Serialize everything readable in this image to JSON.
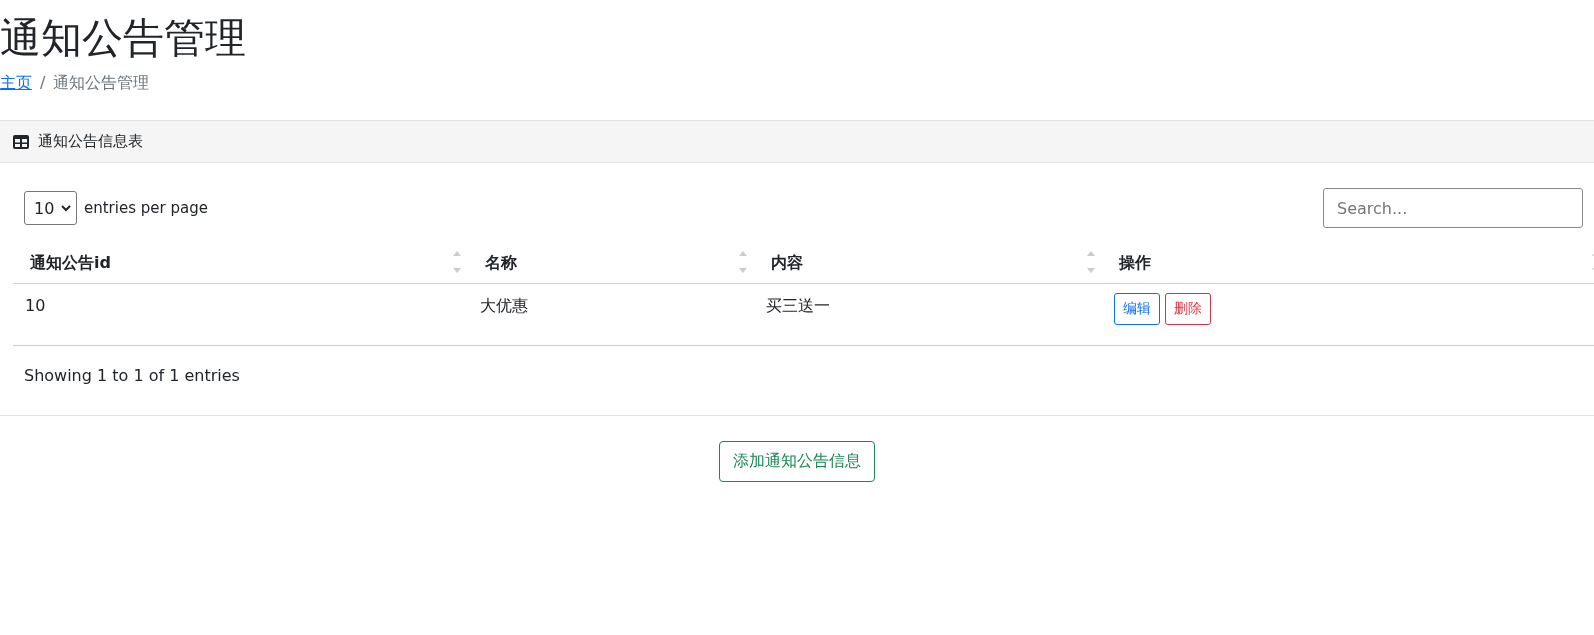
{
  "title": "通知公告管理",
  "breadcrumb": [
    {
      "label": "主页",
      "link": true
    },
    {
      "label": "通知公告管理",
      "link": false
    }
  ],
  "breadcrumb_separator": "/",
  "card": {
    "header": "通知公告信息表",
    "page_size": "10",
    "page_size_label": "entries per page",
    "search": {
      "placeholder": "Search..."
    },
    "columns": [
      "通知公告id",
      "名称",
      "内容",
      "操作"
    ],
    "rows": [
      {
        "cells": [
          "10",
          "大优惠",
          "买三送一"
        ],
        "actions": [
          {
            "label": "编辑",
            "kind": "edit"
          },
          {
            "label": "删除",
            "kind": "delete"
          }
        ]
      }
    ],
    "info": "Showing 1 to 1 of 1 entries"
  },
  "add_button": "添加通知公告信息"
}
